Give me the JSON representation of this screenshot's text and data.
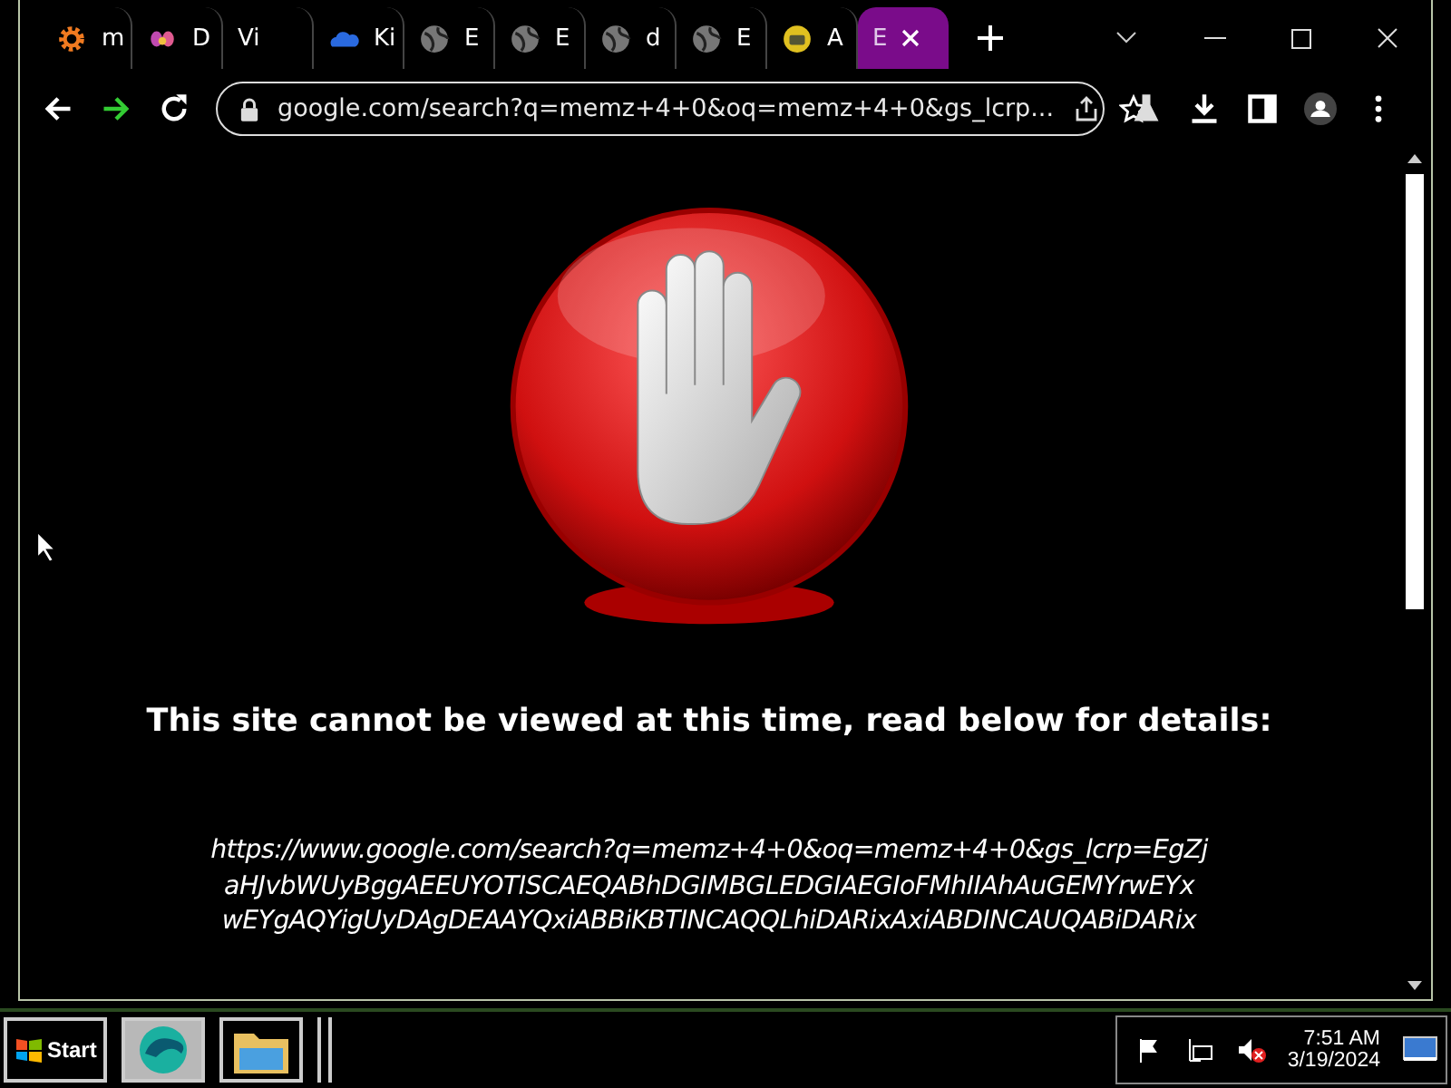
{
  "tabs": [
    {
      "label": "m",
      "kind": "gear",
      "selected": false
    },
    {
      "label": "D",
      "kind": "flower",
      "selected": false
    },
    {
      "label": "Vi",
      "kind": "plain",
      "selected": false
    },
    {
      "label": "Ki",
      "kind": "cloud",
      "selected": false
    },
    {
      "label": "E",
      "kind": "globe",
      "selected": false
    },
    {
      "label": "E",
      "kind": "globe",
      "selected": false
    },
    {
      "label": "d",
      "kind": "globe",
      "selected": false
    },
    {
      "label": "E",
      "kind": "globe",
      "selected": false
    },
    {
      "label": "A",
      "kind": "badge",
      "selected": false
    },
    {
      "label": "E",
      "kind": "plain",
      "selected": true
    }
  ],
  "address_bar": {
    "url": "google.com/search?q=memz+4+0&oq=memz+4+0&gs_lcrp..."
  },
  "page": {
    "heading": "This site cannot be viewed at this time, read below for details:",
    "url_lines": [
      "https://www.google.com/search?q=memz+4+0&oq=memz+4+0&gs_lcrp=EgZj",
      "aHJvbWUyBggAEEUYOTISCAEQABhDGIMBGLEDGIAEGIoFMhIIAhAuGEMYrwEYx",
      "wEYgAQYigUyDAgDEAAYQxiABBiKBTINCAQQLhiDARixAxiABDINCAUQABiDARix"
    ]
  },
  "taskbar": {
    "start": "Start",
    "time": "7:51 AM",
    "date": "3/19/2024"
  }
}
